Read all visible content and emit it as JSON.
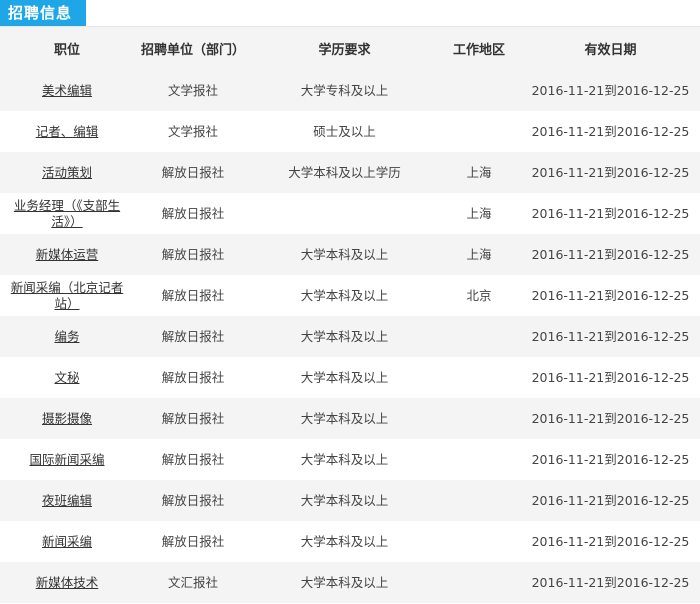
{
  "header": {
    "title": "招聘信息"
  },
  "table": {
    "columns": [
      "职位",
      "招聘单位（部门）",
      "学历要求",
      "工作地区",
      "有效日期"
    ],
    "rows": [
      {
        "position": "美术编辑",
        "unit": "文学报社",
        "education": "大学专科及以上",
        "region": "",
        "date": "2016-11-21到2016-12-25"
      },
      {
        "position": "记者、编辑",
        "unit": "文学报社",
        "education": "硕士及以上",
        "region": "",
        "date": "2016-11-21到2016-12-25"
      },
      {
        "position": "活动策划",
        "unit": "解放日报社",
        "education": "大学本科及以上学历",
        "region": "上海",
        "date": "2016-11-21到2016-12-25"
      },
      {
        "position": "业务经理（《支部生活》）",
        "unit": "解放日报社",
        "education": "",
        "region": "上海",
        "date": "2016-11-21到2016-12-25"
      },
      {
        "position": "新媒体运营",
        "unit": "解放日报社",
        "education": "大学本科及以上",
        "region": "上海",
        "date": "2016-11-21到2016-12-25"
      },
      {
        "position": "新闻采编（北京记者站）",
        "unit": "解放日报社",
        "education": "大学本科及以上",
        "region": "北京",
        "date": "2016-11-21到2016-12-25"
      },
      {
        "position": "编务",
        "unit": "解放日报社",
        "education": "大学本科及以上",
        "region": "",
        "date": "2016-11-21到2016-12-25"
      },
      {
        "position": "文秘",
        "unit": "解放日报社",
        "education": "大学本科及以上",
        "region": "",
        "date": "2016-11-21到2016-12-25"
      },
      {
        "position": "摄影摄像",
        "unit": "解放日报社",
        "education": "大学本科及以上",
        "region": "",
        "date": "2016-11-21到2016-12-25"
      },
      {
        "position": "国际新闻采编",
        "unit": "解放日报社",
        "education": "大学本科及以上",
        "region": "",
        "date": "2016-11-21到2016-12-25"
      },
      {
        "position": "夜班编辑",
        "unit": "解放日报社",
        "education": "大学本科及以上",
        "region": "",
        "date": "2016-11-21到2016-12-25"
      },
      {
        "position": "新闻采编",
        "unit": "解放日报社",
        "education": "大学本科及以上",
        "region": "",
        "date": "2016-11-21到2016-12-25"
      },
      {
        "position": "新媒体技术",
        "unit": "文汇报社",
        "education": "大学本科及以上",
        "region": "",
        "date": "2016-11-21到2016-12-25"
      }
    ]
  },
  "colors": {
    "accent": "#1fa6e6",
    "stripe": "#f4f4f4"
  }
}
